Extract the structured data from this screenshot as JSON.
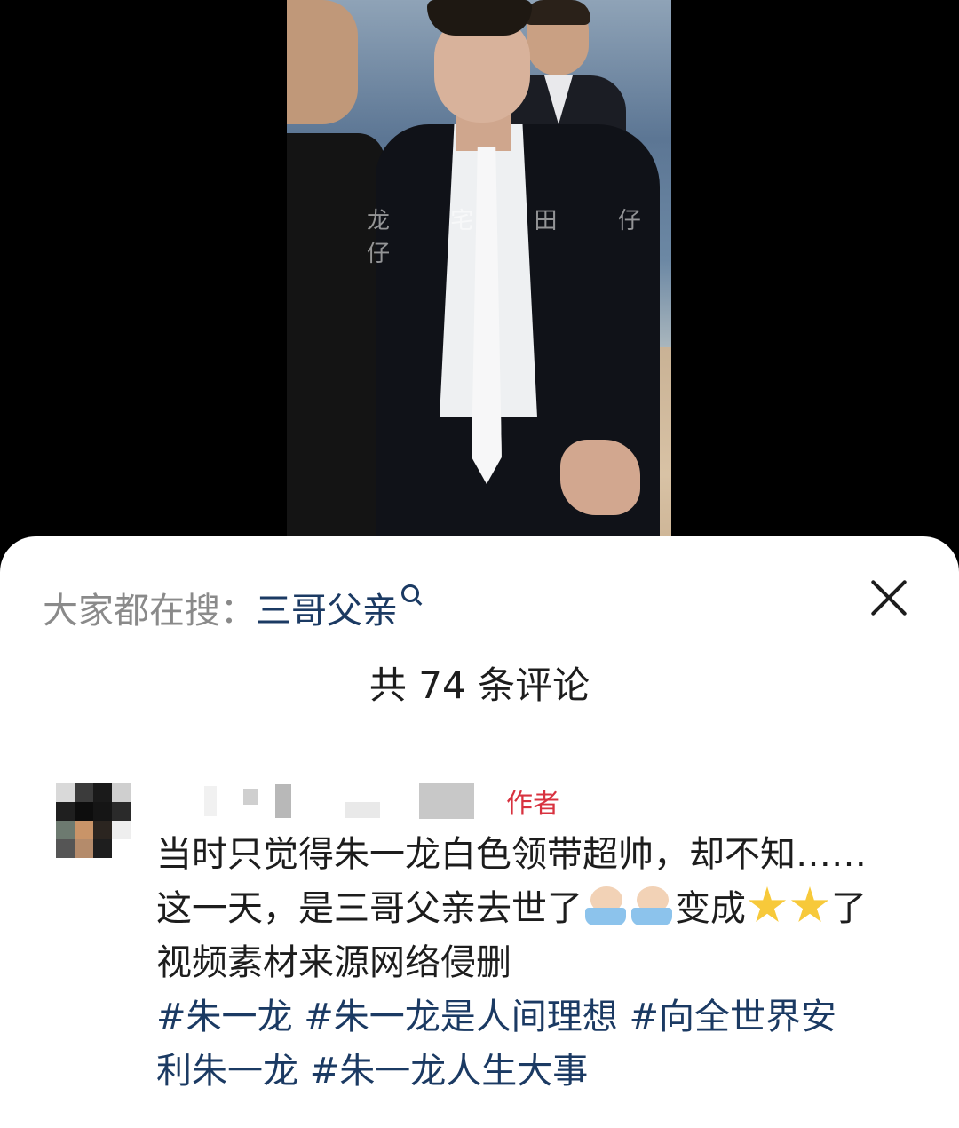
{
  "video": {
    "watermark": "龙 宅 田 仔 仔"
  },
  "search": {
    "prefix": "大家都在搜：",
    "term": "三哥父亲",
    "icon": "search-icon"
  },
  "close_icon": "close-icon",
  "comments_header": {
    "count_text": "共 74 条评论"
  },
  "comment": {
    "author_tag": "作者",
    "line1": "当时只觉得朱一龙白色领带超帅，却不知……",
    "line2_before": "这一天，是三哥父亲去世了",
    "line2_middle": "变成",
    "line2_after": "了",
    "line3": "视频素材来源网络侵删",
    "hashtags_line1": [
      "#朱一龙",
      "#朱一龙是人间理想",
      "#向全世界安"
    ],
    "hashtags_line2": [
      "利朱一龙",
      "#朱一龙人生大事"
    ],
    "emojis": [
      "crying-in-tub-emoji",
      "crying-in-tub-emoji",
      "star-emoji",
      "star-emoji"
    ]
  },
  "colors": {
    "hashtag": "#1b3a63",
    "author_tag": "#d8323f",
    "search_prefix": "#8a8a8a"
  }
}
